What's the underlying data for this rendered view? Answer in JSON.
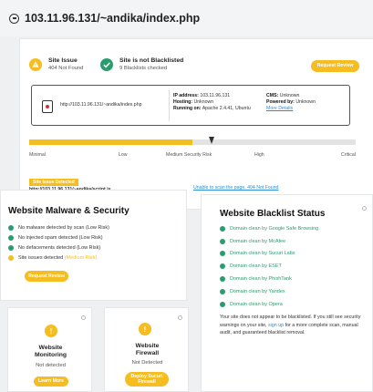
{
  "header": {
    "url": "103.11.96.131/~andika/index.php"
  },
  "summary": {
    "issue": {
      "title": "Site Issue",
      "subtitle": "404 Not Found"
    },
    "blacklist": {
      "title": "Site is not Blacklisted",
      "subtitle": "9 Blacklists checked"
    },
    "request_review_label": "Request Review"
  },
  "site_info": {
    "site_url": "http://103.11.96.131/~andika/index.php",
    "ip_label": "IP address:",
    "ip_value": "103.11.96.131",
    "hosting_label": "Hosting:",
    "hosting_value": "Unknown",
    "running_label": "Running on:",
    "running_value": "Apache 2.4.41, Ubuntu",
    "cms_label": "CMS:",
    "cms_value": "Unknown",
    "powered_label": "Powered by:",
    "powered_value": "Unknown",
    "more_details": "More Details"
  },
  "risk": {
    "labels": [
      "Minimal",
      "Low",
      "Medium Security Risk",
      "High",
      "Critical"
    ],
    "level_fraction": 0.5
  },
  "issue_detected": {
    "tag": "Site Issue Detected",
    "url": "http://103.11.96.131/~andika/script.js",
    "message": "Unable to scan the page. 404 Not Found"
  },
  "malware": {
    "title": "Website Malware & Security",
    "items": [
      {
        "text": "No malware detected by scan (Low Risk)",
        "status": "ok"
      },
      {
        "text": "No injected spam detected (Low Risk)",
        "status": "ok"
      },
      {
        "text": "No defacements detected (Low Risk)",
        "status": "ok"
      },
      {
        "text": "Site issues detected",
        "extra": "(Medium Risk)",
        "status": "warn"
      }
    ],
    "button": "Request Review"
  },
  "blacklist_status": {
    "title": "Website Blacklist Status",
    "items": [
      "Domain clean by Google Safe Browsing",
      "Domain clean by McAfee",
      "Domain clean by Sucuri Labs",
      "Domain clean by ESET",
      "Domain clean by PhishTank",
      "Domain clean by Yandex",
      "Domain clean by Opera"
    ],
    "note_pre": "Your site does not appear to be blacklisted. If you still see security warnings on your site,",
    "note_link": "sign up",
    "note_post": "for a more complete scan, manual audit, and guaranteed blacklist removal."
  },
  "monitoring": {
    "title_line1": "Website",
    "title_line2": "Monitoring",
    "status": "Not detected",
    "button": "Learn More"
  },
  "firewall": {
    "title_line1": "Website",
    "title_line2": "Firewall",
    "status": "Not Detected",
    "button_line1": "Deploy Sucuri",
    "button_line2": "Firewall"
  },
  "colors": {
    "accent": "#f5bd20",
    "ok": "#2a9d6f",
    "link": "#2d8fcf"
  }
}
